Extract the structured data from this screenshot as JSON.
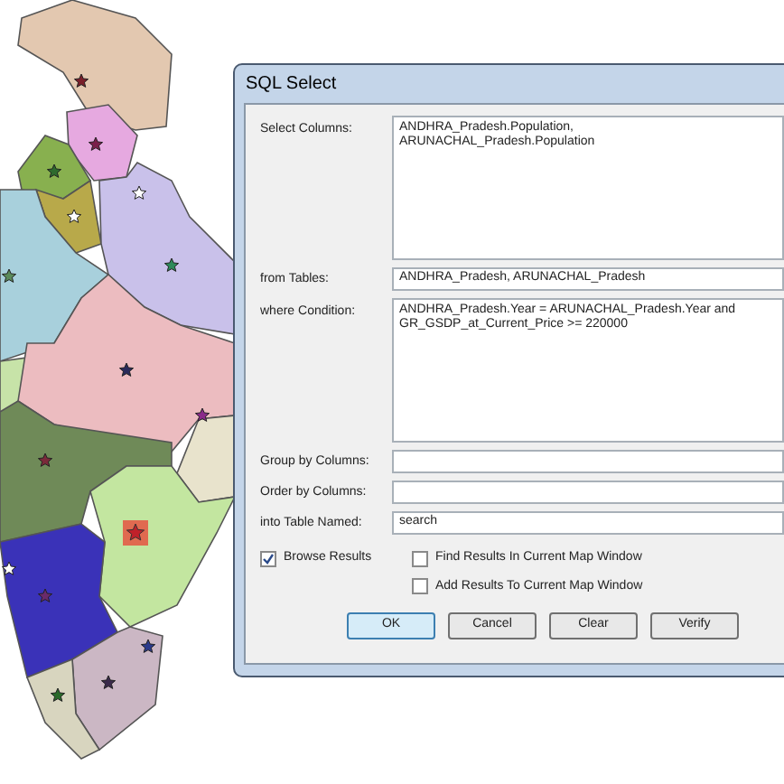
{
  "dialog": {
    "title": "SQL Select",
    "fields": [
      {
        "label": "Select Columns:",
        "kind": "tall",
        "lines": [
          "ANDHRA_Pradesh.Population,",
          "ARUNACHAL_Pradesh.Population"
        ]
      },
      {
        "label": "from Tables:",
        "kind": "line",
        "lines": [
          "ANDHRA_Pradesh, ARUNACHAL_Pradesh"
        ]
      },
      {
        "label": "where Condition:",
        "kind": "tall",
        "lines": [
          "ANDHRA_Pradesh.Year = ARUNACHAL_Pradesh.Year and",
          "GR_GSDP_at_Current_Price >= 220000"
        ]
      },
      {
        "label": "Group by Columns:",
        "kind": "line"
      },
      {
        "label": "Order by Columns:",
        "kind": "line"
      },
      {
        "label": "into Table Named:",
        "kind": "line",
        "lines": [
          "search"
        ]
      }
    ],
    "checkboxes": [
      {
        "label": "Browse Results",
        "checked": true
      },
      {
        "label": "Find Results In Current Map Window",
        "checked": false
      },
      {
        "label": "Add Results To Current Map Window",
        "checked": false
      }
    ],
    "buttons": [
      {
        "label": "OK",
        "selected": true
      },
      {
        "label": "Cancel",
        "selected": false
      },
      {
        "label": "Clear",
        "selected": false
      },
      {
        "label": "Verify",
        "selected": false
      }
    ]
  }
}
